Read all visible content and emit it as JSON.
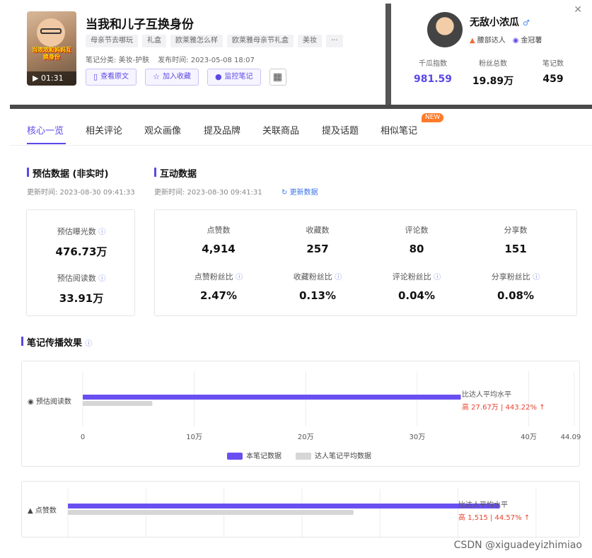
{
  "note": {
    "title": "当我和儿子互换身份",
    "thumb_caption": "当浓浓和妈妈互换身份",
    "duration": "01:31",
    "tags": [
      "母亲节去哪玩",
      "礼盒",
      "欧莱雅怎么样",
      "欧莱雅母亲节礼盒",
      "美妆",
      "···"
    ],
    "category": "笔记分类: 美妆-护肤",
    "publish_time": "发布时间: 2023-05-08 18:07",
    "actions": {
      "view_original": "查看原文",
      "add_favorite": "加入收藏",
      "monitor": "监控笔记"
    }
  },
  "author": {
    "name": "无敌小浓瓜",
    "gender_symbol": "♂",
    "badge1": "腰部达人",
    "badge2": "金冠薯",
    "stats": [
      {
        "label": "千瓜指数",
        "value": "981.59"
      },
      {
        "label": "粉丝总数",
        "value": "19.89万"
      },
      {
        "label": "笔记数",
        "value": "459"
      }
    ]
  },
  "tabs": [
    "核心一览",
    "相关评论",
    "观众画像",
    "提及品牌",
    "关联商品",
    "提及话题",
    "相似笔记"
  ],
  "new_badge": "NEW",
  "estimate": {
    "title": "预估数据 (非实时)",
    "updated": "更新时间: 2023-08-30 09:41:33",
    "exposure_label": "预估曝光数",
    "exposure_value": "476.73万",
    "read_label": "预估阅读数",
    "read_value": "33.91万"
  },
  "interaction": {
    "title": "互动数据",
    "updated": "更新时间: 2023-08-30 09:41:31",
    "update_link": "更新数据",
    "row1": [
      {
        "label": "点赞数",
        "value": "4,914"
      },
      {
        "label": "收藏数",
        "value": "257"
      },
      {
        "label": "评论数",
        "value": "80"
      },
      {
        "label": "分享数",
        "value": "151"
      }
    ],
    "row2": [
      {
        "label": "点赞粉丝比",
        "value": "2.47%"
      },
      {
        "label": "收藏粉丝比",
        "value": "0.13%"
      },
      {
        "label": "评论粉丝比",
        "value": "0.04%"
      },
      {
        "label": "分享粉丝比",
        "value": "0.08%"
      }
    ]
  },
  "spread": {
    "title": "笔记传播效果",
    "compare_label": "比达人平均水平",
    "read_row_label": "预估阅读数",
    "read_compare": "高 27.67万 | 443.22% ↑",
    "like_row_label": "点赞数",
    "like_compare": "高 1,515 | 44.57% ↑",
    "legend_this": "本笔记数据",
    "legend_avg": "达人笔记平均数据"
  },
  "chart_data": [
    {
      "type": "bar",
      "orientation": "horizontal",
      "categories": [
        "预估阅读数"
      ],
      "series": [
        {
          "name": "本笔记数据",
          "values": [
            33.91
          ],
          "color": "#6a4ff0"
        },
        {
          "name": "达人笔记平均数据",
          "values": [
            6.24
          ],
          "color": "#d6d6d6"
        }
      ],
      "xticks": [
        "0",
        "10万",
        "20万",
        "30万",
        "40万",
        "44.09万"
      ],
      "xlim": [
        0,
        44.09
      ],
      "unit": "万"
    },
    {
      "type": "bar",
      "orientation": "horizontal",
      "categories": [
        "点赞数"
      ],
      "series": [
        {
          "name": "本笔记数据",
          "values": [
            4914
          ],
          "color": "#6a4ff0"
        },
        {
          "name": "达人笔记平均数据",
          "values": [
            3399
          ],
          "color": "#d6d6d6"
        }
      ]
    }
  ],
  "watermark": "CSDN @xiguadeyizhimiao"
}
